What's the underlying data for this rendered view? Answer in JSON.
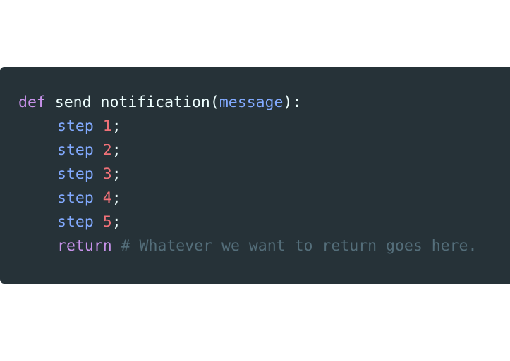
{
  "code": {
    "line1": {
      "keyword": "def",
      "function_name": "send_notification",
      "open_paren": "(",
      "param": "message",
      "close": "):"
    },
    "steps": [
      {
        "word": "step",
        "num": "1",
        "semi": ";"
      },
      {
        "word": "step",
        "num": "2",
        "semi": ";"
      },
      {
        "word": "step",
        "num": "3",
        "semi": ";"
      },
      {
        "word": "step",
        "num": "4",
        "semi": ";"
      },
      {
        "word": "step",
        "num": "5",
        "semi": ";"
      }
    ],
    "return_line": {
      "keyword": "return",
      "comment": "# Whatever we want to return goes here."
    }
  },
  "colors": {
    "background": "#263238",
    "keyword": "#c792ea",
    "identifier": "#82aaff",
    "number": "#f07178",
    "comment": "#546e7a",
    "text": "#eeffff"
  }
}
